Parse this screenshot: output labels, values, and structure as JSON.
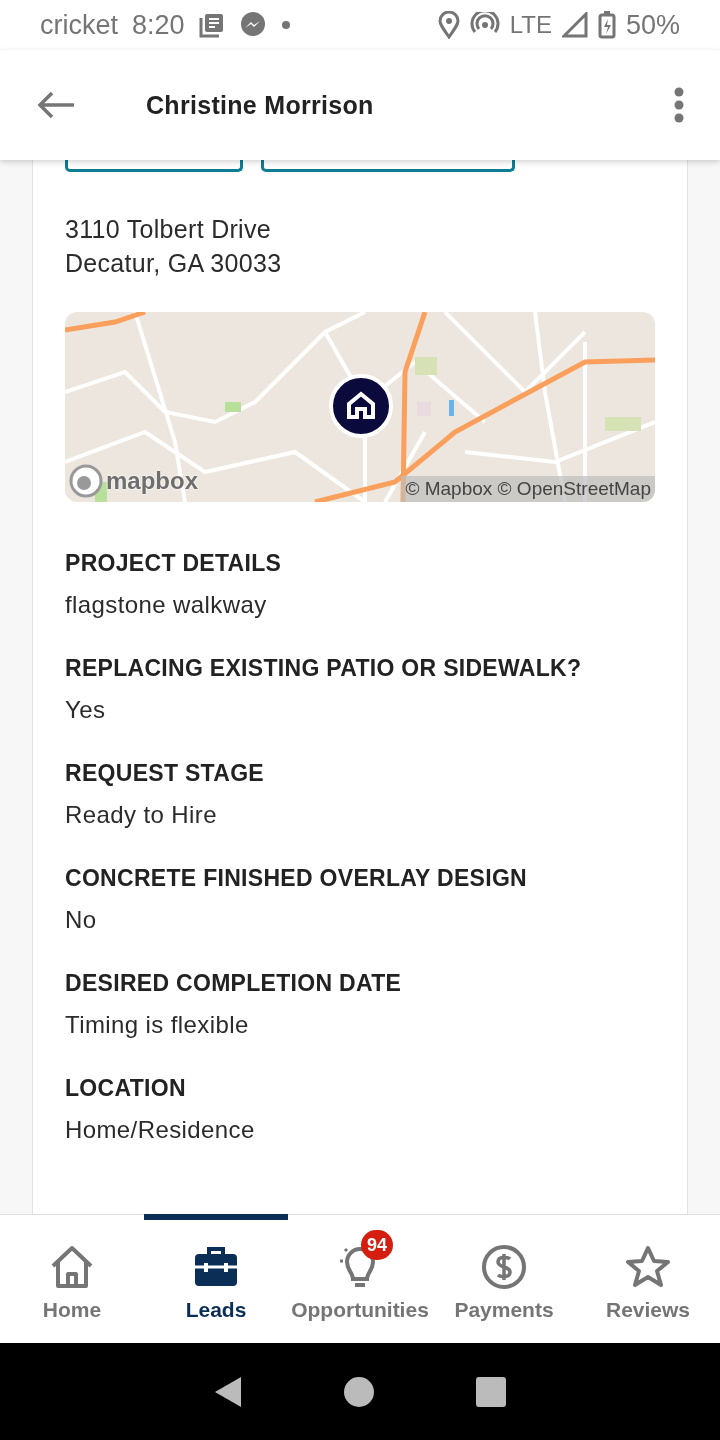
{
  "status_bar": {
    "carrier": "cricket",
    "time": "8:20",
    "network": "LTE",
    "battery": "50%"
  },
  "app_bar": {
    "title": "Christine Morrison"
  },
  "address": {
    "line1": "3110 Tolbert Drive",
    "line2": "Decatur, GA 30033"
  },
  "map": {
    "kind": "picture",
    "logo": "mapbox",
    "attribution": "© Mapbox © OpenStreetMap"
  },
  "details": [
    {
      "label": "PROJECT DETAILS",
      "value": "flagstone walkway"
    },
    {
      "label": "REPLACING EXISTING PATIO OR SIDEWALK?",
      "value": "Yes"
    },
    {
      "label": "REQUEST STAGE",
      "value": "Ready to Hire"
    },
    {
      "label": "CONCRETE FINISHED OVERLAY DESIGN",
      "value": "No"
    },
    {
      "label": "DESIRED COMPLETION DATE",
      "value": "Timing is flexible"
    },
    {
      "label": "LOCATION",
      "value": "Home/Residence"
    }
  ],
  "bottom_nav": [
    {
      "kind": "home",
      "label": "Home",
      "selected": false
    },
    {
      "kind": "leads",
      "label": "Leads",
      "selected": true
    },
    {
      "kind": "opportunities",
      "label": "Opportunities",
      "selected": false,
      "badge": "94"
    },
    {
      "kind": "payments",
      "label": "Payments",
      "selected": false
    },
    {
      "kind": "reviews",
      "label": "Reviews",
      "selected": false
    }
  ]
}
